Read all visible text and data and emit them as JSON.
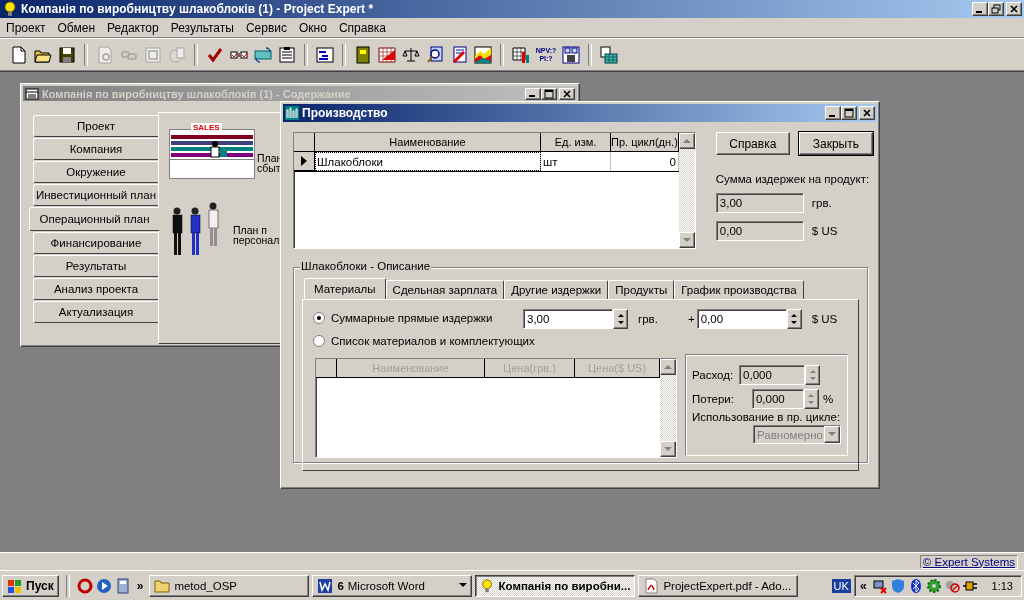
{
  "app": {
    "title": "Компанія по виробництву шлакоблоків (1) - Project Expert *"
  },
  "menu": [
    "Проект",
    "Обмен",
    "Редактор",
    "Результаты",
    "Сервис",
    "Окно",
    "Справка"
  ],
  "toolbar": [
    {
      "kind": "new",
      "disabled": false
    },
    {
      "kind": "open",
      "disabled": false
    },
    {
      "kind": "save",
      "disabled": false
    },
    {
      "kind": "separator"
    },
    {
      "kind": "preview",
      "disabled": true
    },
    {
      "kind": "link",
      "disabled": true
    },
    {
      "kind": "frame",
      "disabled": true
    },
    {
      "kind": "globe",
      "disabled": true
    },
    {
      "kind": "separator"
    },
    {
      "kind": "check",
      "disabled": false
    },
    {
      "kind": "compare",
      "disabled": false
    },
    {
      "kind": "refresh",
      "disabled": false
    },
    {
      "kind": "list",
      "disabled": false
    },
    {
      "kind": "separator"
    },
    {
      "kind": "gantt",
      "disabled": false
    },
    {
      "kind": "separator"
    },
    {
      "kind": "book",
      "disabled": false
    },
    {
      "kind": "grid-chart",
      "disabled": false
    },
    {
      "kind": "scales",
      "disabled": false
    },
    {
      "kind": "search-doc",
      "disabled": false
    },
    {
      "kind": "edit-doc",
      "disabled": false
    },
    {
      "kind": "area-chart",
      "disabled": false
    },
    {
      "kind": "separator"
    },
    {
      "kind": "grid-bars",
      "disabled": false
    },
    {
      "kind": "text",
      "lines": [
        "NPV:?",
        "PI:?"
      ],
      "disabled": false
    },
    {
      "kind": "calc",
      "disabled": false
    },
    {
      "kind": "separator"
    },
    {
      "kind": "table-export",
      "disabled": false
    }
  ],
  "content_window": {
    "title": "Компанія по виробництву шлакоблоків (1) - Содержание",
    "nav": [
      {
        "label": "Проект",
        "selected": false
      },
      {
        "label": "Компания",
        "selected": false
      },
      {
        "label": "Окружение",
        "selected": false
      },
      {
        "label": "Инвестиционный план",
        "selected": false
      },
      {
        "label": "Операционный план",
        "selected": true
      },
      {
        "label": "Финансирование",
        "selected": false
      },
      {
        "label": "Результаты",
        "selected": false
      },
      {
        "label": "Анализ проекта",
        "selected": false
      },
      {
        "label": "Актуализация",
        "selected": false
      }
    ],
    "sections": [
      {
        "kind": "sales",
        "badge": "SALES",
        "lines": [
          "План",
          "сбыт"
        ]
      },
      {
        "kind": "staff",
        "lines": [
          "План п",
          "персонал"
        ]
      }
    ]
  },
  "production_window": {
    "title": "Производство",
    "products_table": {
      "columns": [
        "Наименование",
        "Ед. изм.",
        "Пр. цикл(дн.)"
      ],
      "rows": [
        {
          "cells": [
            "Шлакоблоки",
            "шт",
            "0"
          ],
          "selected": true
        }
      ]
    },
    "buttons": [
      {
        "label": "Справка",
        "default": false
      },
      {
        "label": "Закрыть",
        "default": true
      }
    ],
    "cost_label": "Сумма издержек на продукт:",
    "cost_fields": [
      {
        "value": "3,00",
        "unit": "грв."
      },
      {
        "value": "0,00",
        "unit": "$ US"
      }
    ],
    "group": {
      "title": "Шлакоблоки - Описание",
      "tabs": [
        {
          "label": "Материалы",
          "selected": true
        },
        {
          "label": "Сдельная зарплата",
          "selected": false
        },
        {
          "label": "Другие издержки",
          "selected": false
        },
        {
          "label": "Продукты",
          "selected": false
        },
        {
          "label": "График производства",
          "selected": false
        }
      ],
      "options": [
        {
          "label": "Суммарные прямые издержки",
          "selected": true
        },
        {
          "label": "Список материалов и комплектующих",
          "selected": false
        }
      ],
      "direct_costs": {
        "uah": "3,00",
        "uah_unit": "грв.",
        "plus": "+",
        "usd": "0,00",
        "usd_unit": "$ US"
      },
      "materials_table": {
        "columns": [
          "Наименование",
          "Цена(грв.)",
          "Цена($ US)"
        ],
        "disabled": true
      },
      "usage": {
        "rate_label": "Расход:",
        "rate": "0,000",
        "loss_label": "Потери:",
        "loss": "0,000",
        "loss_unit": "%",
        "mode_label": "Использование в пр. цикле:",
        "mode": "Равномерно",
        "disabled": true
      }
    }
  },
  "status_bar": {
    "link": "© Expert Systems"
  },
  "taskbar": {
    "start": "Пуск",
    "chevron": "»",
    "tasks": [
      {
        "kind": "folder",
        "label": "metod_OSP",
        "selected": false
      },
      {
        "kind": "word-group",
        "count": "6",
        "label": "Microsoft Word",
        "selected": false
      },
      {
        "kind": "app",
        "label": "Компанія по виробни...",
        "selected": true
      },
      {
        "kind": "pdf",
        "label": "ProjectExpert.pdf - Ado...",
        "selected": false
      }
    ],
    "language": "UK",
    "tray_chevron": "«",
    "clock": "1:13"
  }
}
